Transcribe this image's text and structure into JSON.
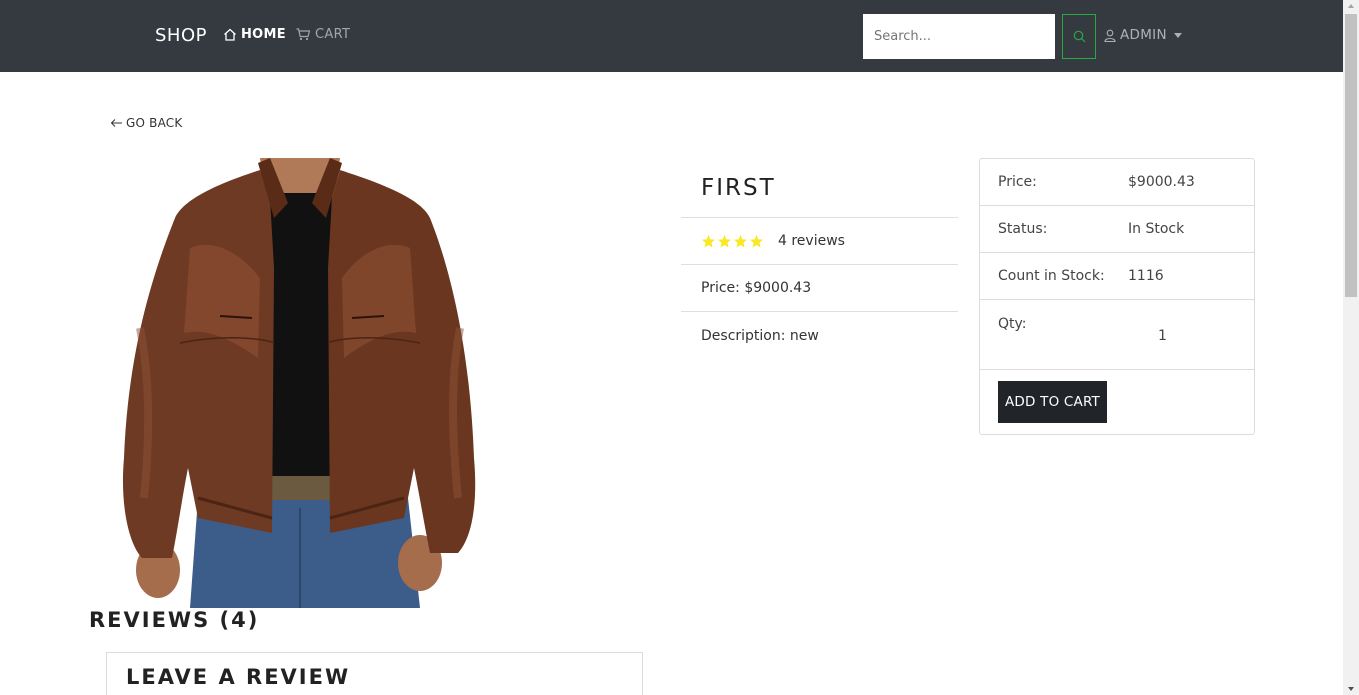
{
  "navbar": {
    "brand": "SHOP",
    "home_label": "HOME",
    "cart_label": "CART",
    "search_placeholder": "Search...",
    "admin_label": "ADMIN",
    "bg_color": "#343a40",
    "search_button_border": "#28a745"
  },
  "go_back_label": "GO BACK",
  "product": {
    "image_alt": "brown leather jacket",
    "name": "FIRST",
    "rating": 4,
    "rating_max": 4,
    "reviews_text": "4 reviews",
    "price_text": "Price: $9000.43",
    "description_text": "Description: new"
  },
  "card": {
    "price_label": "Price:",
    "price_value": "$9000.43",
    "status_label": "Status:",
    "status_value": "In Stock",
    "count_label": "Count in Stock:",
    "count_value": "1116",
    "qty_label": "Qty:",
    "qty_value": "1",
    "add_button": "ADD TO CART"
  },
  "reviews": {
    "heading": "REVIEWS (4)",
    "leave_heading": "LEAVE A REVIEW"
  },
  "icons": {
    "home": "home-icon",
    "cart": "cart-icon",
    "search": "search-icon",
    "user": "user-icon",
    "back": "arrow-left-icon",
    "star": "star-icon"
  },
  "colors": {
    "star": "#f8e825",
    "button_dark": "#212529"
  }
}
